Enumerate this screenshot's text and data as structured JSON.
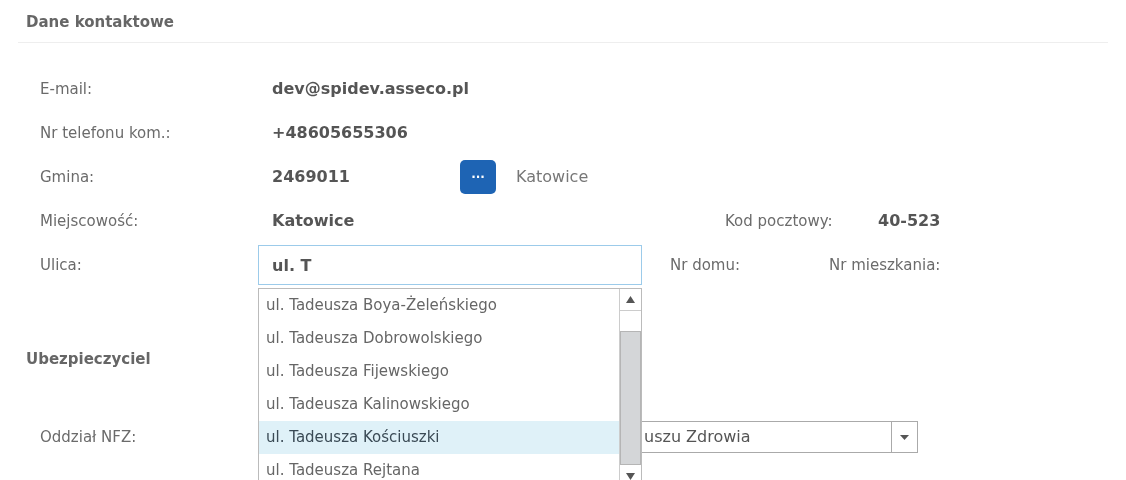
{
  "contact": {
    "title": "Dane kontaktowe",
    "email": {
      "label": "E-mail:",
      "value": "dev@spidev.asseco.pl"
    },
    "phone": {
      "label": "Nr telefonu kom.:",
      "value": "+48605655306"
    },
    "gmina": {
      "label": "Gmina:",
      "value": "2469011",
      "button": "···",
      "name": "Katowice"
    },
    "city": {
      "label": "Miejscowość:",
      "value": "Katowice"
    },
    "postal": {
      "label": "Kod pocztowy:",
      "value": "40-523"
    },
    "street": {
      "label": "Ulica:",
      "value": "ul. T"
    },
    "house": {
      "label": "Nr domu:"
    },
    "flat": {
      "label": "Nr mieszkania:"
    },
    "suggestions": [
      {
        "text": "ul. Tadeusza Boya-Żeleńskiego",
        "selected": false
      },
      {
        "text": "ul. Tadeusza Dobrowolskiego",
        "selected": false
      },
      {
        "text": "ul. Tadeusza Fijewskiego",
        "selected": false
      },
      {
        "text": "ul. Tadeusza Kalinowskiego",
        "selected": false
      },
      {
        "text": "ul. Tadeusza Kościuszki",
        "selected": true
      },
      {
        "text": "ul. Tadeusza Rejtana",
        "selected": false
      }
    ]
  },
  "insurer": {
    "title": "Ubezpieczyciel",
    "nfz": {
      "label": "Oddział NFZ:",
      "value": "uszu Zdrowia"
    }
  }
}
